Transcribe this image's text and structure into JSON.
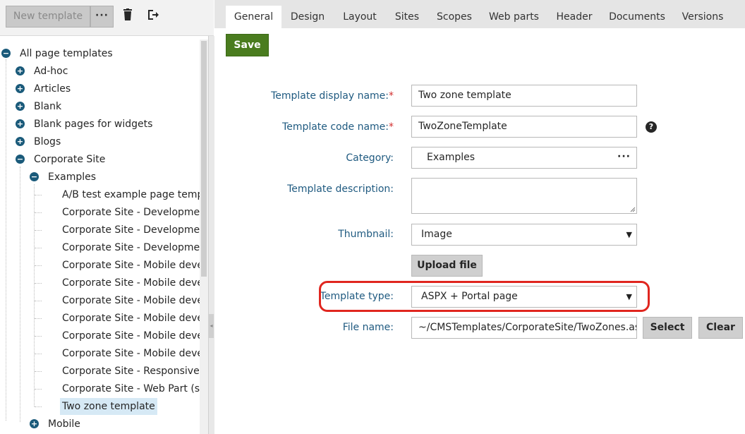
{
  "toolbar": {
    "new_template": "New template",
    "more": "···",
    "delete_icon": "trash-icon",
    "exit_icon": "exit-icon"
  },
  "tree": {
    "root": "All page templates",
    "items": [
      "Ad-hoc",
      "Articles",
      "Blank",
      "Blank pages for widgets",
      "Blogs",
      "Corporate Site",
      "Examples",
      "A/B test example page template",
      "Corporate Site - Development n",
      "Corporate Site - Development n",
      "Corporate Site - Development n",
      "Corporate Site - Mobile develop",
      "Corporate Site - Mobile develop",
      "Corporate Site - Mobile develop",
      "Corporate Site - Mobile develop",
      "Corporate Site - Mobile develop",
      "Corporate Site - Mobile develop",
      "Corporate Site - Responsive Ma",
      "Corporate Site - Web Part (sam",
      "Two zone template",
      "Mobile"
    ]
  },
  "tabs": [
    "General",
    "Design",
    "Layout",
    "Sites",
    "Scopes",
    "Web parts",
    "Header",
    "Documents",
    "Versions"
  ],
  "form": {
    "save_label": "Save",
    "display_name_label": "Template display name:",
    "display_name_value": "Two zone template",
    "code_name_label": "Template code name:",
    "code_name_value": "TwoZoneTemplate",
    "required_mark": "*",
    "category_label": "Category:",
    "category_value": "Examples",
    "category_more": "···",
    "description_label": "Template description:",
    "description_value": "",
    "thumbnail_label": "Thumbnail:",
    "thumbnail_value": "Image",
    "upload_label": "Upload file",
    "template_type_label": "Template type:",
    "template_type_value": "ASPX + Portal page",
    "file_name_label": "File name:",
    "file_name_value": "~/CMSTemplates/CorporateSite/TwoZones.aspx",
    "select_label": "Select",
    "clear_label": "Clear",
    "help": "?",
    "dropdown_arrow": "▼"
  },
  "colors": {
    "accent_green": "#4a7c1f",
    "label_blue": "#1f5a80",
    "highlight_red": "#e0261f",
    "tree_expander": "#1a5a7a",
    "selected_bg": "#d6e9f5"
  }
}
